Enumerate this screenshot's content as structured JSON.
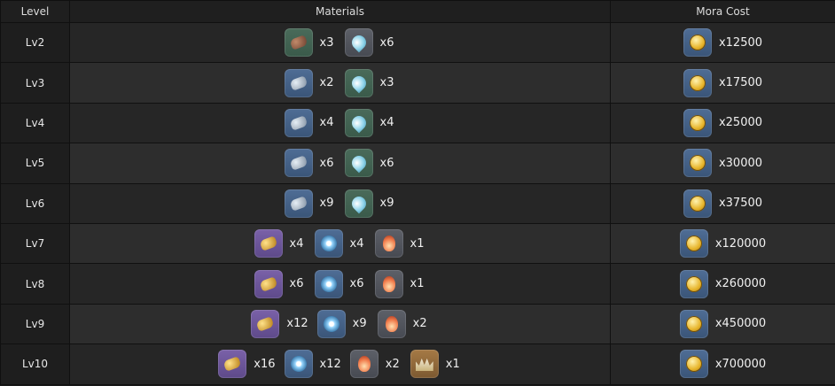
{
  "headers": {
    "level": "Level",
    "materials": "Materials",
    "mora": "Mora Cost"
  },
  "icons": {
    "m1": "brown-chunk-icon",
    "m2": "silver-chunk-icon",
    "m3": "gold-chunk-icon",
    "s1": "blue-droplet-icon",
    "s2": "blue-ring-icon",
    "f": "flame-icon",
    "c": "crown-icon",
    "mora": "mora-coin-icon"
  },
  "rows": [
    {
      "level": "Lv2",
      "materials": [
        {
          "icon": "m1",
          "qty": "x3",
          "rarity": "green"
        },
        {
          "icon": "s1",
          "qty": "x6",
          "rarity": "gray"
        }
      ],
      "mora": "x12500"
    },
    {
      "level": "Lv3",
      "materials": [
        {
          "icon": "m2",
          "qty": "x2",
          "rarity": "blue"
        },
        {
          "icon": "s1",
          "qty": "x3",
          "rarity": "green"
        }
      ],
      "mora": "x17500"
    },
    {
      "level": "Lv4",
      "materials": [
        {
          "icon": "m2",
          "qty": "x4",
          "rarity": "blue"
        },
        {
          "icon": "s1",
          "qty": "x4",
          "rarity": "green"
        }
      ],
      "mora": "x25000"
    },
    {
      "level": "Lv5",
      "materials": [
        {
          "icon": "m2",
          "qty": "x6",
          "rarity": "blue"
        },
        {
          "icon": "s1",
          "qty": "x6",
          "rarity": "green"
        }
      ],
      "mora": "x30000"
    },
    {
      "level": "Lv6",
      "materials": [
        {
          "icon": "m2",
          "qty": "x9",
          "rarity": "blue"
        },
        {
          "icon": "s1",
          "qty": "x9",
          "rarity": "green"
        }
      ],
      "mora": "x37500"
    },
    {
      "level": "Lv7",
      "materials": [
        {
          "icon": "m3",
          "qty": "x4",
          "rarity": "purple"
        },
        {
          "icon": "s2",
          "qty": "x4",
          "rarity": "blue"
        },
        {
          "icon": "f",
          "qty": "x1",
          "rarity": "gray"
        }
      ],
      "mora": "x120000"
    },
    {
      "level": "Lv8",
      "materials": [
        {
          "icon": "m3",
          "qty": "x6",
          "rarity": "purple"
        },
        {
          "icon": "s2",
          "qty": "x6",
          "rarity": "blue"
        },
        {
          "icon": "f",
          "qty": "x1",
          "rarity": "gray"
        }
      ],
      "mora": "x260000"
    },
    {
      "level": "Lv9",
      "materials": [
        {
          "icon": "m3",
          "qty": "x12",
          "rarity": "purple"
        },
        {
          "icon": "s2",
          "qty": "x9",
          "rarity": "blue"
        },
        {
          "icon": "f",
          "qty": "x2",
          "rarity": "gray"
        }
      ],
      "mora": "x450000"
    },
    {
      "level": "Lv10",
      "materials": [
        {
          "icon": "m3",
          "qty": "x16",
          "rarity": "purple"
        },
        {
          "icon": "s2",
          "qty": "x12",
          "rarity": "blue"
        },
        {
          "icon": "f",
          "qty": "x2",
          "rarity": "gray"
        },
        {
          "icon": "c",
          "qty": "x1",
          "rarity": "gold"
        }
      ],
      "mora": "x700000"
    }
  ]
}
